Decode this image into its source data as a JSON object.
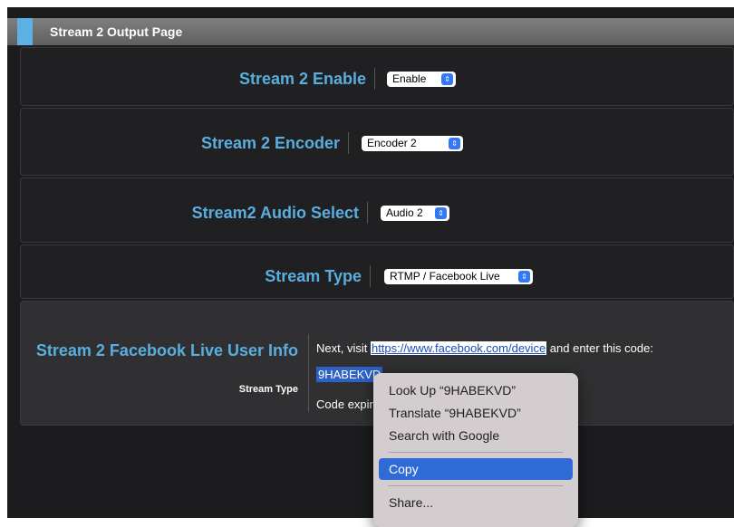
{
  "page": {
    "title": "Stream 2 Output Page"
  },
  "rows": {
    "enable": {
      "label": "Stream 2 Enable",
      "value": "Enable"
    },
    "encoder": {
      "label": "Stream 2 Encoder",
      "value": "Encoder 2"
    },
    "audio": {
      "label": "Stream2 Audio Select",
      "value": "Audio 2"
    },
    "stream_type": {
      "label": "Stream Type",
      "value": "RTMP / Facebook Live"
    }
  },
  "facebook": {
    "title": "Stream 2 Facebook Live User Info",
    "subtitle": "Stream Type",
    "line1_prefix": "Next, visit ",
    "link": "https://www.facebook.com/device",
    "line1_suffix": " and enter this code:",
    "code": "9HABEKVD",
    "expire_text": "Code expir"
  },
  "context_menu": {
    "items": [
      {
        "label": "Look Up “9HABEKVD”"
      },
      {
        "label": "Translate “9HABEKVD”"
      },
      {
        "label": "Search with Google"
      },
      {
        "label": "Copy"
      },
      {
        "label": "Share..."
      }
    ]
  },
  "icons": {
    "stepper": "up-down-stepper-icon"
  },
  "colors": {
    "accent": "#5aaede",
    "header_accent": "#5db0e4",
    "select_stepper": "#3478f6",
    "menu_highlight": "#2f6bd7"
  }
}
